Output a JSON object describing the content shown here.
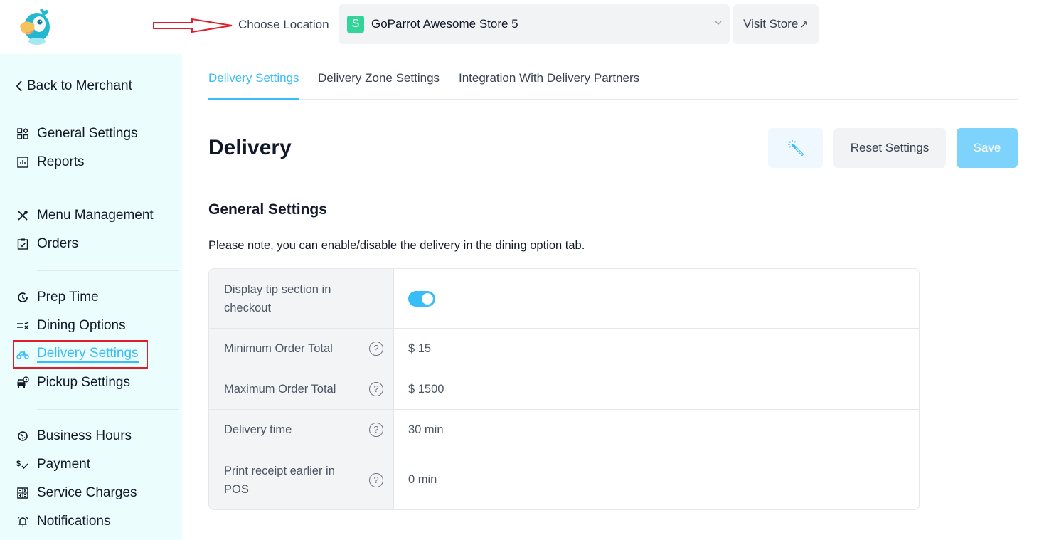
{
  "header": {
    "choose_location_label": "Choose Location",
    "selected_store": {
      "badge": "S",
      "name": "GoParrot Awesome Store 5",
      "badge_color": "#34d399"
    },
    "visit_store_label": "Visit Store",
    "visit_store_icon": "↗"
  },
  "sidebar": {
    "back_label": "Back to Merchant",
    "groups": [
      [
        {
          "label": "General Settings",
          "icon": "grid-icon"
        },
        {
          "label": "Reports",
          "icon": "chart-icon"
        }
      ],
      [
        {
          "label": "Menu Management",
          "icon": "utensils-icon"
        },
        {
          "label": "Orders",
          "icon": "clipboard-check-icon"
        }
      ],
      [
        {
          "label": "Prep Time",
          "icon": "clock-refresh-icon"
        },
        {
          "label": "Dining Options",
          "icon": "list-x-icon"
        },
        {
          "label": "Delivery Settings",
          "icon": "scooter-icon",
          "active": true
        },
        {
          "label": "Pickup Settings",
          "icon": "car-clock-icon"
        }
      ],
      [
        {
          "label": "Business Hours",
          "icon": "timer-icon"
        },
        {
          "label": "Payment",
          "icon": "dollar-check-icon"
        },
        {
          "label": "Service Charges",
          "icon": "calculator-icon"
        },
        {
          "label": "Notifications",
          "icon": "bell-icon"
        }
      ]
    ]
  },
  "tabs": [
    {
      "label": "Delivery Settings",
      "active": true
    },
    {
      "label": "Delivery Zone Settings",
      "active": false
    },
    {
      "label": "Integration With Delivery Partners",
      "active": false
    }
  ],
  "page": {
    "title": "Delivery",
    "reset_label": "Reset Settings",
    "save_label": "Save",
    "section_title": "General Settings",
    "note": "Please note, you can enable/disable the delivery in the dining option tab."
  },
  "settings": [
    {
      "label": "Display tip section in checkout",
      "type": "toggle",
      "value": true,
      "help": false
    },
    {
      "label": "Minimum Order Total",
      "type": "text",
      "value": "$ 15",
      "help": true
    },
    {
      "label": "Maximum Order Total",
      "type": "text",
      "value": "$ 1500",
      "help": true
    },
    {
      "label": "Delivery time",
      "type": "text",
      "value": "30 min",
      "help": true
    },
    {
      "label": "Print receipt earlier in POS",
      "type": "text",
      "value": "0 min",
      "help": true
    }
  ],
  "help_glyph": "?",
  "colors": {
    "accent": "#38bdf8",
    "sidebar_bg": "#ecfdfe",
    "save_bg": "#7dd3fc",
    "annotation": "#e11d2a"
  }
}
